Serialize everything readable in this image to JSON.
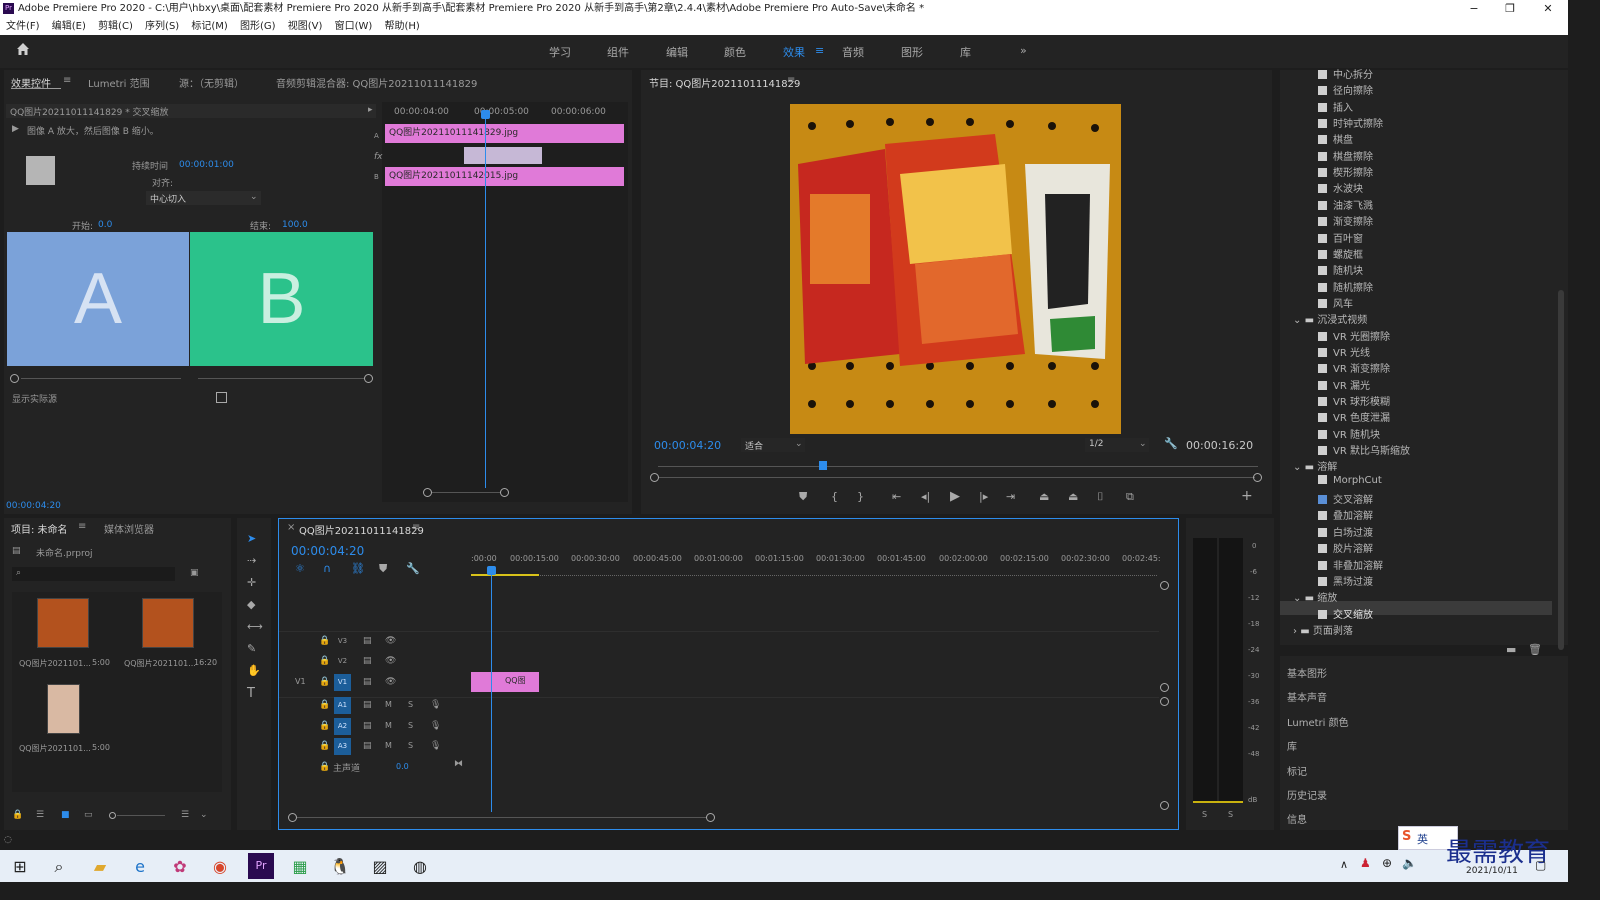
{
  "window": {
    "title": "Adobe Premiere Pro 2020 - C:\\用户\\hbxy\\桌面\\配套素材 Premiere Pro 2020 从新手到高手\\配套素材 Premiere Pro 2020 从新手到高手\\第2章\\2.4.4\\素材\\Adobe Premiere Pro Auto-Save\\未命名 *",
    "app_icon": "Pr",
    "minimize": "−",
    "restore": "❐",
    "close": "✕"
  },
  "menu": [
    "文件(F)",
    "编辑(E)",
    "剪辑(C)",
    "序列(S)",
    "标记(M)",
    "图形(G)",
    "视图(V)",
    "窗口(W)",
    "帮助(H)"
  ],
  "workspaces": {
    "items": [
      "学习",
      "组件",
      "编辑",
      "颜色",
      "效果",
      "音频",
      "图形",
      "库"
    ],
    "active": "效果",
    "more": "»"
  },
  "effect_controls": {
    "tabs": [
      "效果控件",
      "Lumetri 范围",
      "源：（无剪辑）",
      "音频剪辑混合器: QQ图片20211011141829"
    ],
    "clip_name": "QQ图片20211011141829 * 交叉缩放",
    "description": "图像 A 放大，然后图像 B 缩小。",
    "duration_label": "持续时间",
    "duration_value": "00:00:01:00",
    "align_label": "对齐:",
    "align_value": "中心切入",
    "start_label": "开始:",
    "start_value": "0.0",
    "end_label": "结束:",
    "end_value": "100.0",
    "preview_a": "A",
    "preview_b": "B",
    "show_actual_sources": "显示实际源",
    "timecode": "00:00:04:20",
    "mini_timeline": {
      "ruler": [
        "00:00:04:00",
        "00:00:05:00",
        "00:00:06:00"
      ],
      "clip_a": "QQ图片20211011141829.jpg",
      "clip_b": "QQ图片20211011142015.jpg",
      "track_a": "A",
      "track_b": "B",
      "fx": "fx"
    }
  },
  "program": {
    "title": "节目: QQ图片20211011141829",
    "timecode": "00:00:04:20",
    "fit": "适合",
    "resolution": "1/2",
    "duration": "00:00:16:20"
  },
  "effects_panel": {
    "items": [
      {
        "label": "中心拆分",
        "indent": 2
      },
      {
        "label": "径向擦除",
        "indent": 2
      },
      {
        "label": "插入",
        "indent": 2
      },
      {
        "label": "时钟式擦除",
        "indent": 2
      },
      {
        "label": "棋盘",
        "indent": 2
      },
      {
        "label": "棋盘擦除",
        "indent": 2
      },
      {
        "label": "楔形擦除",
        "indent": 2
      },
      {
        "label": "水波块",
        "indent": 2
      },
      {
        "label": "油漆飞溅",
        "indent": 2
      },
      {
        "label": "渐变擦除",
        "indent": 2
      },
      {
        "label": "百叶窗",
        "indent": 2
      },
      {
        "label": "螺旋框",
        "indent": 2
      },
      {
        "label": "随机块",
        "indent": 2
      },
      {
        "label": "随机擦除",
        "indent": 2
      },
      {
        "label": "风车",
        "indent": 2
      },
      {
        "label": "沉浸式视频",
        "indent": 1,
        "folder": true
      },
      {
        "label": "VR 光圈擦除",
        "indent": 2
      },
      {
        "label": "VR 光线",
        "indent": 2
      },
      {
        "label": "VR 渐变擦除",
        "indent": 2
      },
      {
        "label": "VR 漏光",
        "indent": 2
      },
      {
        "label": "VR 球形模糊",
        "indent": 2
      },
      {
        "label": "VR 色度泄漏",
        "indent": 2
      },
      {
        "label": "VR 随机块",
        "indent": 2
      },
      {
        "label": "VR 默比乌斯缩放",
        "indent": 2
      },
      {
        "label": "溶解",
        "indent": 1,
        "folder": true
      },
      {
        "label": "MorphCut",
        "indent": 2
      },
      {
        "label": "交叉溶解",
        "indent": 2
      },
      {
        "label": "叠加溶解",
        "indent": 2
      },
      {
        "label": "白场过渡",
        "indent": 2
      },
      {
        "label": "胶片溶解",
        "indent": 2
      },
      {
        "label": "非叠加溶解",
        "indent": 2
      },
      {
        "label": "黑场过渡",
        "indent": 2
      },
      {
        "label": "缩放",
        "indent": 1,
        "folder": true
      },
      {
        "label": "交叉缩放",
        "indent": 2,
        "selected": true
      },
      {
        "label": "页面剥落",
        "indent": 1,
        "folder": true,
        "collapsed": true
      }
    ],
    "sections": [
      "基本图形",
      "基本声音",
      "Lumetri 颜色",
      "库",
      "标记",
      "历史记录",
      "信息"
    ]
  },
  "project": {
    "tabs": [
      "项目: 未命名",
      "媒体浏览器"
    ],
    "file": "未命名.prproj",
    "items": [
      {
        "name": "QQ图片2021101...",
        "duration": "5:00"
      },
      {
        "name": "QQ图片2021101...",
        "duration": "16:20"
      },
      {
        "name": "QQ图片2021101...",
        "duration": "5:00"
      }
    ]
  },
  "timeline": {
    "tab": "QQ图片20211011141829",
    "close": "×",
    "timecode": "00:00:04:20",
    "ruler": [
      ":00:00",
      "00:00:15:00",
      "00:00:30:00",
      "00:00:45:00",
      "00:01:00:00",
      "00:01:15:00",
      "00:01:30:00",
      "00:01:45:00",
      "00:02:00:00",
      "00:02:15:00",
      "00:02:30:00",
      "00:02:45:"
    ],
    "tracks": [
      "V3",
      "V2",
      "V1",
      "A1",
      "A2",
      "A3"
    ],
    "source_v1": "V1",
    "master": "主声道",
    "master_value": "0.0",
    "clip": "QQ图",
    "m": "M",
    "s": "S"
  },
  "meters": {
    "scale": [
      "0",
      "-6",
      "-12",
      "-18",
      "-24",
      "-30",
      "-36",
      "-42",
      "-48",
      "dB"
    ],
    "solo": [
      "S",
      "S"
    ]
  },
  "taskbar": {
    "date": "2021/10/11",
    "ime": "英",
    "watermark": "最需教育"
  },
  "colors": {
    "accent": "#2d8ceb",
    "clip": "#e07ad8",
    "preview_a": "#7ba2d9",
    "preview_b": "#2bc28b"
  }
}
